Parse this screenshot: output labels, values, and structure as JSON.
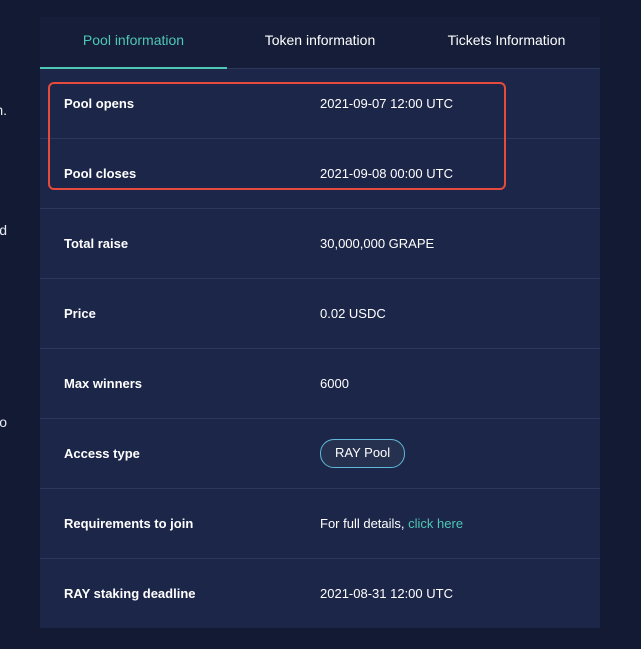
{
  "tabs": [
    {
      "label": "Pool information"
    },
    {
      "label": "Token information"
    },
    {
      "label": "Tickets Information"
    }
  ],
  "rows": [
    {
      "label": "Pool opens",
      "value": "2021-09-07 12:00 UTC"
    },
    {
      "label": "Pool closes",
      "value": "2021-09-08 00:00 UTC"
    },
    {
      "label": "Total raise",
      "value": "30,000,000 GRAPE"
    },
    {
      "label": "Price",
      "value": "0.02 USDC"
    },
    {
      "label": "Max winners",
      "value": "6000"
    },
    {
      "label": "Access type",
      "value": "RAY Pool"
    },
    {
      "label": "Requirements to join",
      "value_prefix": "For full details, ",
      "link_text": "click here"
    },
    {
      "label": "RAY staking deadline",
      "value": "2021-08-31 12:00 UTC"
    }
  ],
  "left_fragments": [
    "n.",
    "d",
    "o"
  ],
  "colors": {
    "background": "#131a33",
    "panel": "#1c2648",
    "accent": "#4fc7b6",
    "highlight": "#e54b3c"
  }
}
